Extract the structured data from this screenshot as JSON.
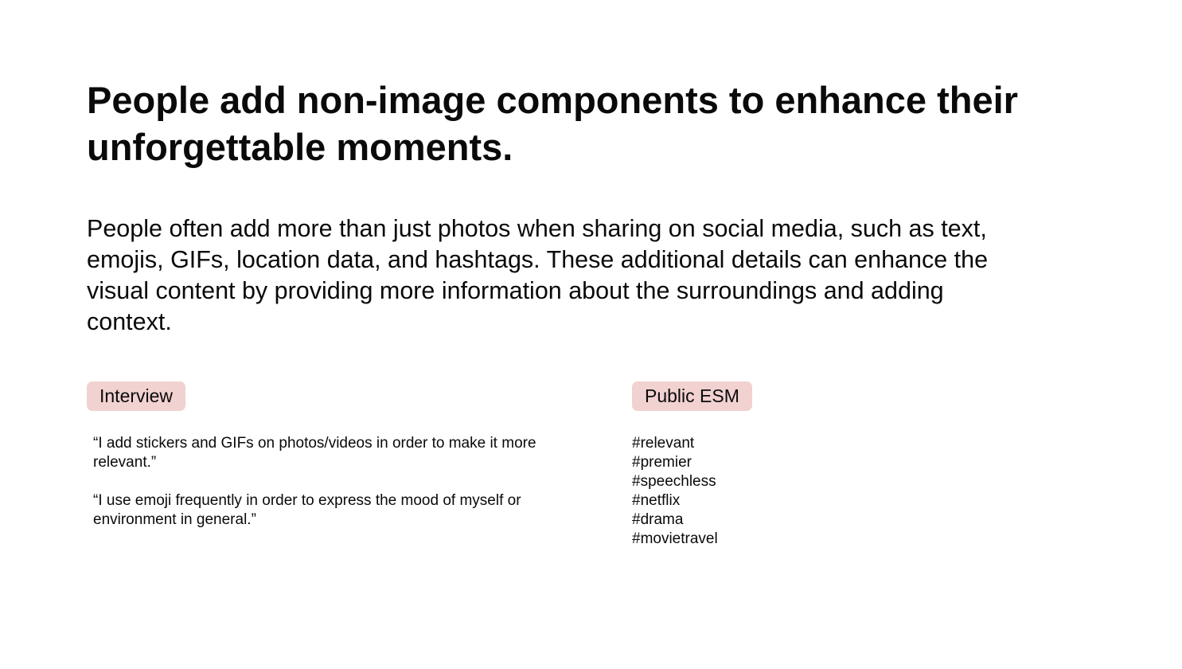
{
  "heading": "People add non-image components to enhance their unforgettable moments.",
  "body_text": "People often add more than just photos when sharing on social media, such as text, emojis, GIFs, location data, and hashtags. These additional details can enhance the visual content by providing more information about the surroundings and adding context.",
  "interview": {
    "label": "Interview",
    "quotes": [
      "“I add stickers and GIFs on photos/videos in order to make it more relevant.”",
      "“I use emoji frequently in order to express the mood of myself or environment  in general.”"
    ]
  },
  "public_esm": {
    "label": "Public ESM",
    "hashtags": [
      "#relevant",
      "#premier",
      "#speechless",
      "#netflix",
      "#drama",
      "#movietravel"
    ]
  },
  "colors": {
    "tag_background": "#f2d1d1",
    "text": "#0a0a0a",
    "background": "#ffffff"
  }
}
